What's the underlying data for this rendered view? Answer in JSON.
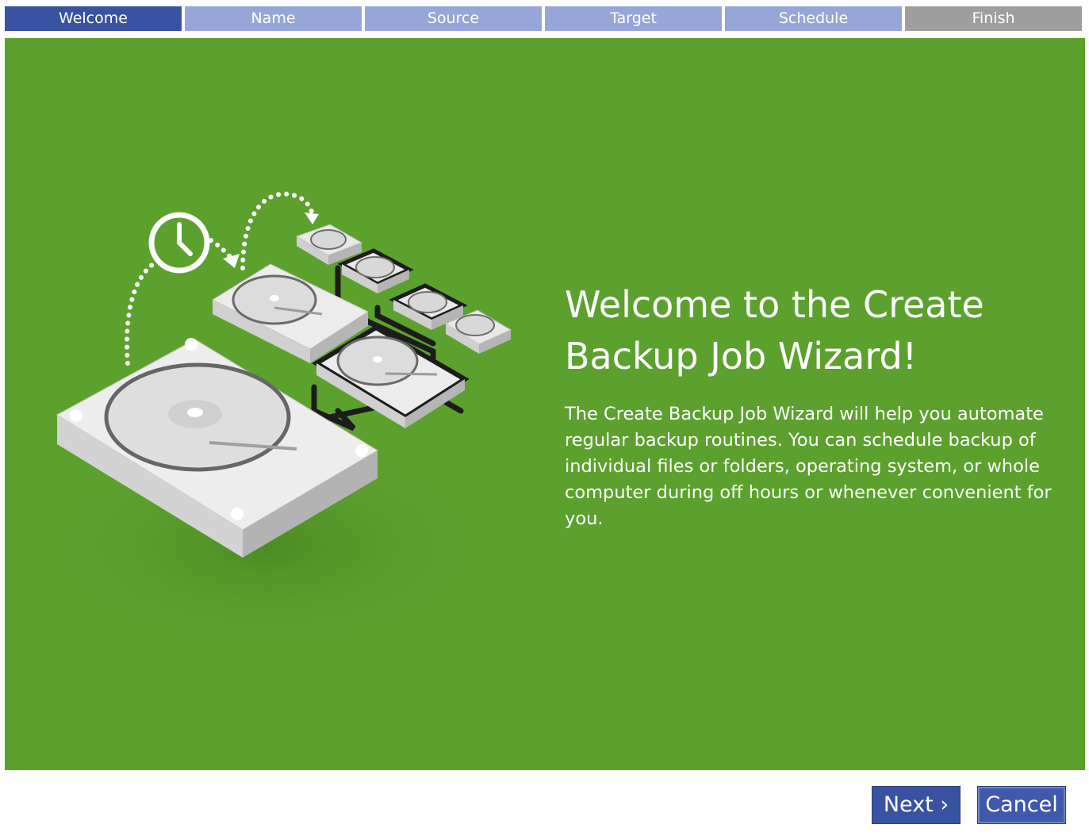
{
  "steps": [
    {
      "label": "Welcome",
      "active": true
    },
    {
      "label": "Name",
      "active": false
    },
    {
      "label": "Source",
      "active": false
    },
    {
      "label": "Target",
      "active": false
    },
    {
      "label": "Schedule",
      "active": false
    },
    {
      "label": "Finish",
      "active": false
    }
  ],
  "main": {
    "title": "Welcome to the Create Backup Job Wizard!",
    "description": "The Create Backup Job Wizard will help you automate regular backup routines. You can schedule backup of individual files or folders, operating system, or whole computer during off hours or whenever convenient for you."
  },
  "illustration": {
    "icons": [
      "clock-icon",
      "hard-drive-icon",
      "dotted-arrow-icon"
    ]
  },
  "buttons": {
    "next": "Next ›",
    "cancel": "Cancel"
  },
  "colors": {
    "panel_bg": "#5ca12e",
    "step_active": "#3a52a2",
    "step_inactive": "#96a6d8",
    "step_finish": "#9e9e9e",
    "button_bg": "#3a52a2"
  }
}
